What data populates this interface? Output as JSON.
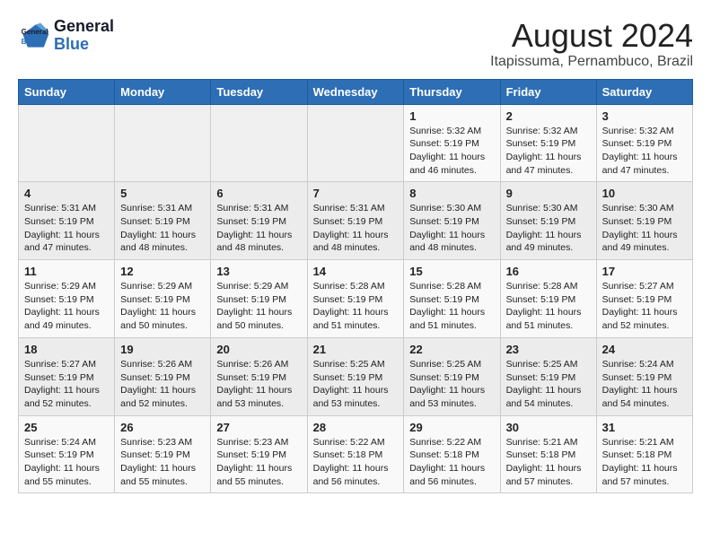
{
  "header": {
    "logo_line1": "General",
    "logo_line2": "Blue",
    "title": "August 2024",
    "subtitle": "Itapissuma, Pernambuco, Brazil"
  },
  "weekdays": [
    "Sunday",
    "Monday",
    "Tuesday",
    "Wednesday",
    "Thursday",
    "Friday",
    "Saturday"
  ],
  "weeks": [
    [
      {
        "day": "",
        "info": ""
      },
      {
        "day": "",
        "info": ""
      },
      {
        "day": "",
        "info": ""
      },
      {
        "day": "",
        "info": ""
      },
      {
        "day": "1",
        "info": "Sunrise: 5:32 AM\nSunset: 5:19 PM\nDaylight: 11 hours and 46 minutes."
      },
      {
        "day": "2",
        "info": "Sunrise: 5:32 AM\nSunset: 5:19 PM\nDaylight: 11 hours and 47 minutes."
      },
      {
        "day": "3",
        "info": "Sunrise: 5:32 AM\nSunset: 5:19 PM\nDaylight: 11 hours and 47 minutes."
      }
    ],
    [
      {
        "day": "4",
        "info": "Sunrise: 5:31 AM\nSunset: 5:19 PM\nDaylight: 11 hours and 47 minutes."
      },
      {
        "day": "5",
        "info": "Sunrise: 5:31 AM\nSunset: 5:19 PM\nDaylight: 11 hours and 48 minutes."
      },
      {
        "day": "6",
        "info": "Sunrise: 5:31 AM\nSunset: 5:19 PM\nDaylight: 11 hours and 48 minutes."
      },
      {
        "day": "7",
        "info": "Sunrise: 5:31 AM\nSunset: 5:19 PM\nDaylight: 11 hours and 48 minutes."
      },
      {
        "day": "8",
        "info": "Sunrise: 5:30 AM\nSunset: 5:19 PM\nDaylight: 11 hours and 48 minutes."
      },
      {
        "day": "9",
        "info": "Sunrise: 5:30 AM\nSunset: 5:19 PM\nDaylight: 11 hours and 49 minutes."
      },
      {
        "day": "10",
        "info": "Sunrise: 5:30 AM\nSunset: 5:19 PM\nDaylight: 11 hours and 49 minutes."
      }
    ],
    [
      {
        "day": "11",
        "info": "Sunrise: 5:29 AM\nSunset: 5:19 PM\nDaylight: 11 hours and 49 minutes."
      },
      {
        "day": "12",
        "info": "Sunrise: 5:29 AM\nSunset: 5:19 PM\nDaylight: 11 hours and 50 minutes."
      },
      {
        "day": "13",
        "info": "Sunrise: 5:29 AM\nSunset: 5:19 PM\nDaylight: 11 hours and 50 minutes."
      },
      {
        "day": "14",
        "info": "Sunrise: 5:28 AM\nSunset: 5:19 PM\nDaylight: 11 hours and 51 minutes."
      },
      {
        "day": "15",
        "info": "Sunrise: 5:28 AM\nSunset: 5:19 PM\nDaylight: 11 hours and 51 minutes."
      },
      {
        "day": "16",
        "info": "Sunrise: 5:28 AM\nSunset: 5:19 PM\nDaylight: 11 hours and 51 minutes."
      },
      {
        "day": "17",
        "info": "Sunrise: 5:27 AM\nSunset: 5:19 PM\nDaylight: 11 hours and 52 minutes."
      }
    ],
    [
      {
        "day": "18",
        "info": "Sunrise: 5:27 AM\nSunset: 5:19 PM\nDaylight: 11 hours and 52 minutes."
      },
      {
        "day": "19",
        "info": "Sunrise: 5:26 AM\nSunset: 5:19 PM\nDaylight: 11 hours and 52 minutes."
      },
      {
        "day": "20",
        "info": "Sunrise: 5:26 AM\nSunset: 5:19 PM\nDaylight: 11 hours and 53 minutes."
      },
      {
        "day": "21",
        "info": "Sunrise: 5:25 AM\nSunset: 5:19 PM\nDaylight: 11 hours and 53 minutes."
      },
      {
        "day": "22",
        "info": "Sunrise: 5:25 AM\nSunset: 5:19 PM\nDaylight: 11 hours and 53 minutes."
      },
      {
        "day": "23",
        "info": "Sunrise: 5:25 AM\nSunset: 5:19 PM\nDaylight: 11 hours and 54 minutes."
      },
      {
        "day": "24",
        "info": "Sunrise: 5:24 AM\nSunset: 5:19 PM\nDaylight: 11 hours and 54 minutes."
      }
    ],
    [
      {
        "day": "25",
        "info": "Sunrise: 5:24 AM\nSunset: 5:19 PM\nDaylight: 11 hours and 55 minutes."
      },
      {
        "day": "26",
        "info": "Sunrise: 5:23 AM\nSunset: 5:19 PM\nDaylight: 11 hours and 55 minutes."
      },
      {
        "day": "27",
        "info": "Sunrise: 5:23 AM\nSunset: 5:19 PM\nDaylight: 11 hours and 55 minutes."
      },
      {
        "day": "28",
        "info": "Sunrise: 5:22 AM\nSunset: 5:18 PM\nDaylight: 11 hours and 56 minutes."
      },
      {
        "day": "29",
        "info": "Sunrise: 5:22 AM\nSunset: 5:18 PM\nDaylight: 11 hours and 56 minutes."
      },
      {
        "day": "30",
        "info": "Sunrise: 5:21 AM\nSunset: 5:18 PM\nDaylight: 11 hours and 57 minutes."
      },
      {
        "day": "31",
        "info": "Sunrise: 5:21 AM\nSunset: 5:18 PM\nDaylight: 11 hours and 57 minutes."
      }
    ]
  ]
}
